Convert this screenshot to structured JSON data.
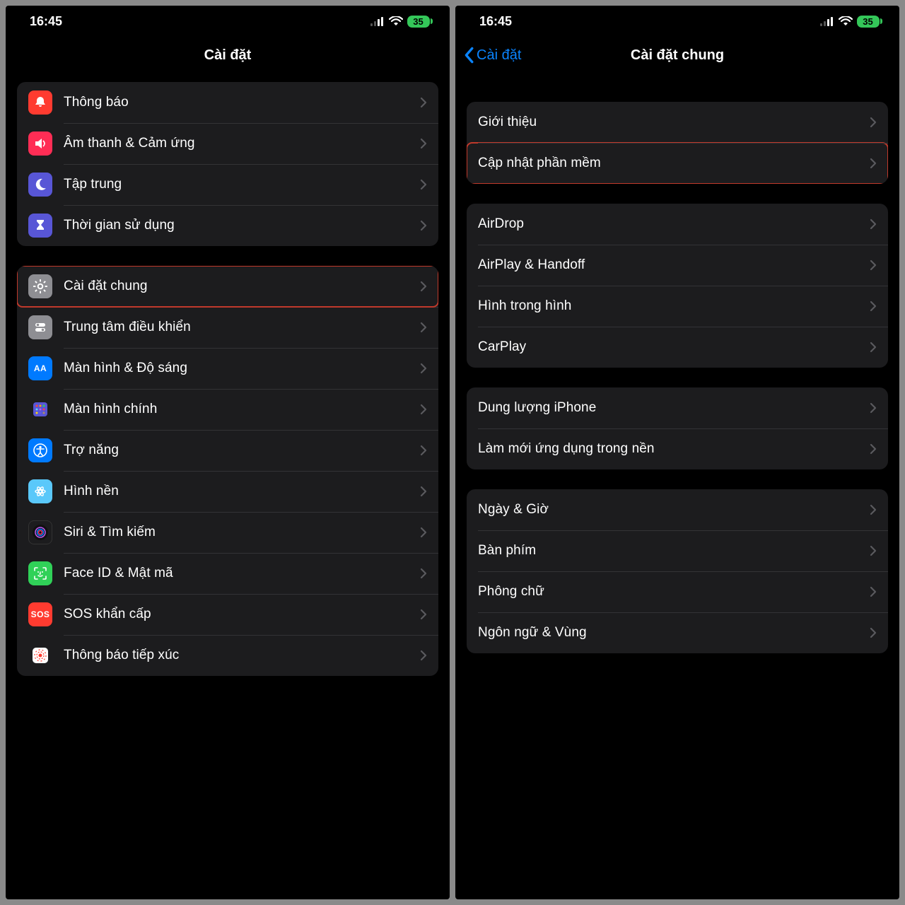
{
  "status": {
    "time": "16:45",
    "battery": "35"
  },
  "left": {
    "title": "Cài đặt",
    "groups": [
      {
        "rows": [
          {
            "icon": "bell",
            "color": "ic-red",
            "label": "Thông báo"
          },
          {
            "icon": "volume",
            "color": "ic-pink",
            "label": "Âm thanh & Cảm ứng"
          },
          {
            "icon": "moon",
            "color": "ic-indigo",
            "label": "Tập trung"
          },
          {
            "icon": "hourglass",
            "color": "ic-indigo",
            "label": "Thời gian sử dụng"
          }
        ]
      },
      {
        "rows": [
          {
            "icon": "gear",
            "color": "ic-gray",
            "label": "Cài đặt chung",
            "highlight": true
          },
          {
            "icon": "toggles",
            "color": "ic-gray",
            "label": "Trung tâm điều khiển"
          },
          {
            "icon": "AA",
            "color": "ic-blue",
            "label": "Màn hình & Độ sáng",
            "textIcon": true
          },
          {
            "icon": "apps",
            "color": "ic-indigo",
            "label": "Màn hình chính"
          },
          {
            "icon": "access",
            "color": "ic-blue",
            "label": "Trợ năng"
          },
          {
            "icon": "flower",
            "color": "ic-cyan",
            "label": "Hình nền"
          },
          {
            "icon": "siri",
            "color": "ic-black",
            "label": "Siri & Tìm kiếm"
          },
          {
            "icon": "faceid",
            "color": "ic-green",
            "label": "Face ID & Mật mã"
          },
          {
            "icon": "SOS",
            "color": "ic-sos",
            "label": "SOS khẩn cấp",
            "textIcon": true
          },
          {
            "icon": "exposure",
            "color": "ic-white",
            "label": "Thông báo tiếp xúc"
          }
        ]
      }
    ]
  },
  "right": {
    "back": "Cài đặt",
    "title": "Cài đặt chung",
    "groups": [
      {
        "rows": [
          {
            "label": "Giới thiệu"
          },
          {
            "label": "Cập nhật phần mềm",
            "highlight": true
          }
        ]
      },
      {
        "rows": [
          {
            "label": "AirDrop"
          },
          {
            "label": "AirPlay & Handoff"
          },
          {
            "label": "Hình trong hình"
          },
          {
            "label": "CarPlay"
          }
        ]
      },
      {
        "rows": [
          {
            "label": "Dung lượng iPhone"
          },
          {
            "label": "Làm mới ứng dụng trong nền"
          }
        ]
      },
      {
        "rows": [
          {
            "label": "Ngày & Giờ"
          },
          {
            "label": "Bàn phím"
          },
          {
            "label": "Phông chữ"
          },
          {
            "label": "Ngôn ngữ & Vùng"
          }
        ]
      }
    ]
  }
}
